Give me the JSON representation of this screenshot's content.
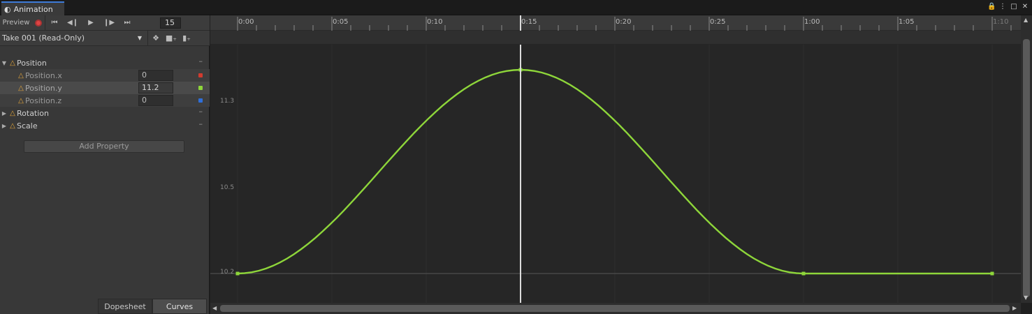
{
  "window": {
    "tab_title": "Animation",
    "buttons": [
      "lock-icon",
      "menu-icon",
      "maximize-icon",
      "close-icon"
    ]
  },
  "toolbar": {
    "preview_label": "Preview",
    "frame_value": "15"
  },
  "clip": {
    "name": "Take 001 (Read-Only)"
  },
  "properties": {
    "position": "Position",
    "position_x": "Position.x",
    "position_x_value": "0",
    "position_y": "Position.y",
    "position_y_value": "11.2",
    "position_z": "Position.z",
    "position_z_value": "0",
    "rotation": "Rotation",
    "scale": "Scale"
  },
  "add_property_label": "Add Property",
  "bottom_tabs": {
    "dopesheet": "Dopesheet",
    "curves": "Curves"
  },
  "ruler": {
    "labels": [
      "0:00",
      "0:05",
      "0:10",
      "0:15",
      "0:20",
      "0:25",
      "1:00",
      "1:05",
      "1:10"
    ]
  },
  "curve_axis": {
    "labels": [
      "11.3",
      "10.5",
      "10.2"
    ]
  },
  "colors": {
    "curve": "#8ed63a",
    "x_channel": "#d23b2f",
    "y_channel": "#8ed63a",
    "z_channel": "#2f6fd9",
    "tab_accent": "#3d7bd9"
  },
  "curve": {
    "current_frame": 15,
    "keyframes": [
      {
        "frame": 0,
        "value": 10.2
      },
      {
        "frame": 15,
        "value": 11.2
      },
      {
        "frame": 30,
        "value": 10.2
      },
      {
        "frame": 40,
        "value": 10.2
      }
    ]
  }
}
